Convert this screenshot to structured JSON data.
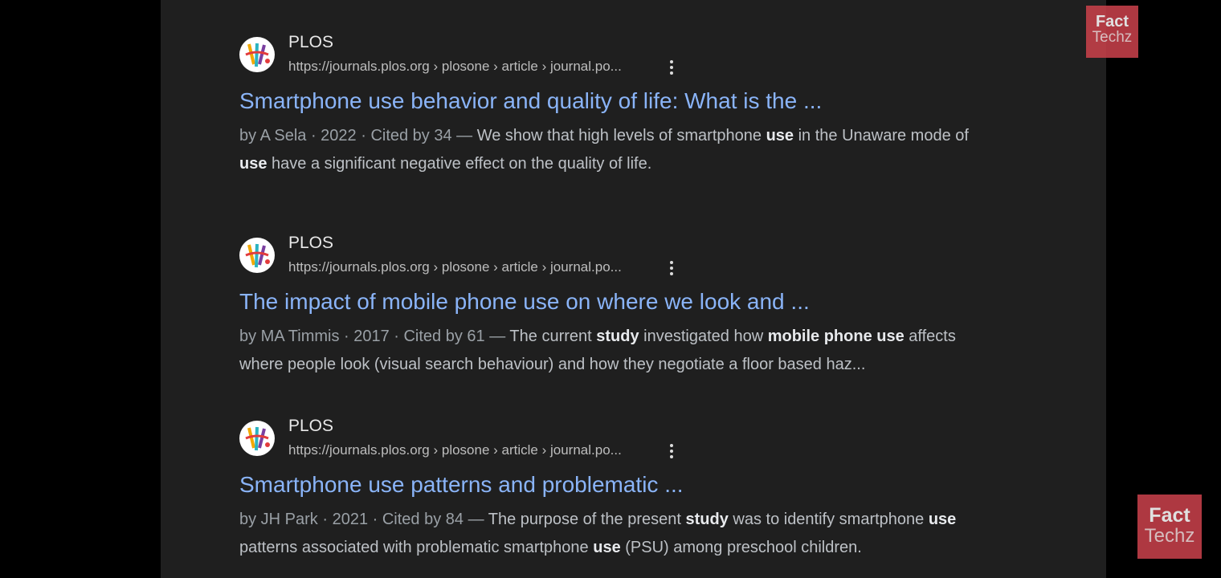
{
  "results": [
    {
      "site_name": "PLOS",
      "url": "https://journals.plos.org › plosone › article › journal.po...",
      "title": "Smartphone use behavior and quality of life: What is the ...",
      "meta": "by A Sela · 2022 · Cited by 34 — ",
      "snippet_parts": [
        {
          "text": "We show that high levels of smartphone ",
          "bold": false
        },
        {
          "text": "use",
          "bold": true
        },
        {
          "text": " in the Unaware mode of ",
          "bold": false
        },
        {
          "text": "use",
          "bold": true
        },
        {
          "text": " have a significant negative effect on the quality of life.",
          "bold": false
        }
      ]
    },
    {
      "site_name": "PLOS",
      "url": "https://journals.plos.org › plosone › article › journal.po...",
      "title": "The impact of mobile phone use on where we look and ...",
      "meta": "by MA Timmis · 2017 · Cited by 61 — ",
      "snippet_parts": [
        {
          "text": "The current ",
          "bold": false
        },
        {
          "text": "study",
          "bold": true
        },
        {
          "text": " investigated how ",
          "bold": false
        },
        {
          "text": "mobile phone use",
          "bold": true
        },
        {
          "text": " affects where people look (visual search behaviour) and how they negotiate a floor based haz...",
          "bold": false
        }
      ]
    },
    {
      "site_name": "PLOS",
      "url": "https://journals.plos.org › plosone › article › journal.po...",
      "title": "Smartphone use patterns and problematic ...",
      "meta": "by JH Park · 2021 · Cited by 84 — ",
      "snippet_parts": [
        {
          "text": "The purpose of the present ",
          "bold": false
        },
        {
          "text": "study",
          "bold": true
        },
        {
          "text": " was to identify smartphone ",
          "bold": false
        },
        {
          "text": "use",
          "bold": true
        },
        {
          "text": " patterns associated with problematic smartphone ",
          "bold": false
        },
        {
          "text": "use",
          "bold": true
        },
        {
          "text": " (PSU) among preschool children.",
          "bold": false
        }
      ]
    }
  ],
  "watermark": {
    "line1": "Fact",
    "line2": "Techz"
  },
  "colors": {
    "background": "#1f1f1f",
    "title_link": "#8ab4f8",
    "snippet_text": "#bdc1c6",
    "watermark_bg": "#c7404a"
  },
  "icons": {
    "favicon": "plos-logo-icon",
    "more": "more-vert-icon"
  }
}
